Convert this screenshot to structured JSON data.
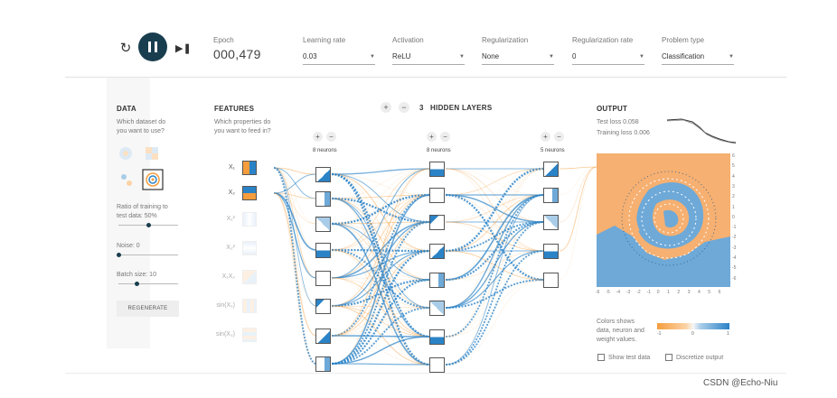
{
  "controls": {
    "epoch_label": "Epoch",
    "epoch_value": "000,479",
    "dropdowns": [
      {
        "label": "Learning rate",
        "value": "0.03"
      },
      {
        "label": "Activation",
        "value": "ReLU"
      },
      {
        "label": "Regularization",
        "value": "None"
      },
      {
        "label": "Regularization rate",
        "value": "0"
      },
      {
        "label": "Problem type",
        "value": "Classification"
      }
    ]
  },
  "data_section": {
    "title": "DATA",
    "question": [
      "Which dataset do",
      "you want to use?"
    ],
    "ratio_label": [
      "Ratio of training to",
      "test data:  50%"
    ],
    "ratio_value": 0.5,
    "noise_label": "Noise:  0",
    "noise_value": 0,
    "batch_label": "Batch size:  10",
    "batch_value": 0.3,
    "regenerate_label": "REGENERATE"
  },
  "features_section": {
    "title": "FEATURES",
    "question": [
      "Which properties do",
      "you want to feed in?"
    ],
    "features": [
      "X₁",
      "X₂",
      "X₁²",
      "X₂²",
      "X₁X₂",
      "sin(X₁)",
      "sin(X₂)"
    ]
  },
  "hidden_layers": {
    "count_label": "3",
    "title": "HIDDEN LAYERS",
    "layer_labels": [
      "8 neurons",
      "8 neurons",
      "5 neurons"
    ],
    "plus": "+",
    "minus": "−"
  },
  "output_section": {
    "title": "OUTPUT",
    "test_loss": "Test loss 0.058",
    "training_loss": "Training loss 0.006",
    "axis_ticks": [
      "6",
      "5",
      "4",
      "3",
      "2",
      "1",
      "0",
      "-1",
      "-2",
      "-3",
      "-4",
      "-5",
      "-6"
    ],
    "legend_text": [
      "Colors shows",
      "data, neuron and",
      "weight values."
    ],
    "legend_ticks": [
      "-1",
      "0",
      "1"
    ],
    "show_test_data": "Show test data",
    "discretize_output": "Discretize output"
  },
  "colors": {
    "orange": "#f59d3d",
    "blue": "#2b83c7",
    "dark": "#183d4e"
  },
  "watermark": "CSDN @Echo-Niu"
}
